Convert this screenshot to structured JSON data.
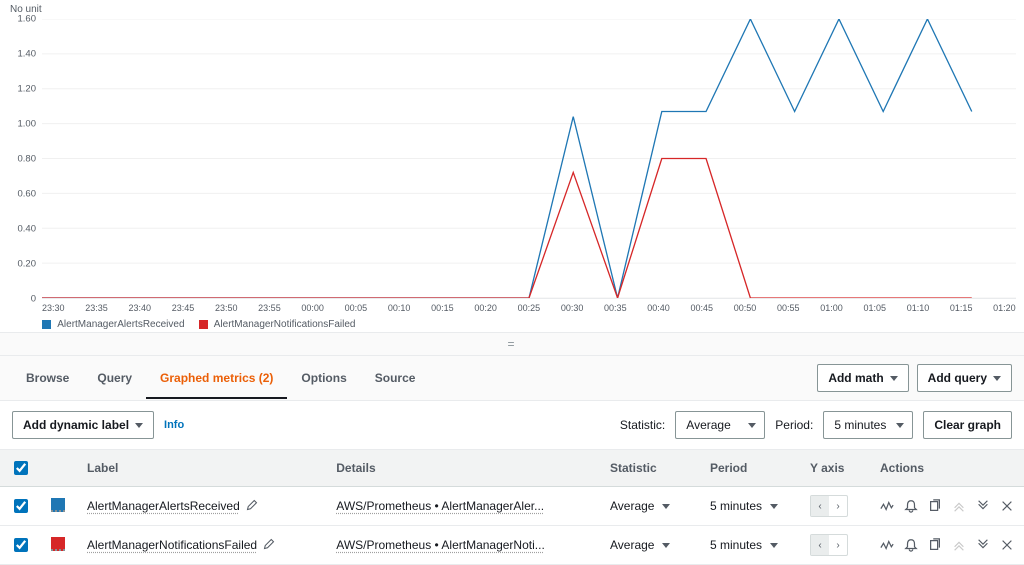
{
  "chart": {
    "nounit_label": "No unit"
  },
  "legend": {
    "series1": "AlertManagerAlertsReceived",
    "series2": "AlertManagerNotificationsFailed"
  },
  "tabs": {
    "browse": "Browse",
    "query": "Query",
    "graphed": "Graphed metrics (2)",
    "options": "Options",
    "source": "Source"
  },
  "toolbar": {
    "add_math": "Add math",
    "add_query": "Add query"
  },
  "controls": {
    "add_dynamic_label": "Add dynamic label",
    "info": "Info",
    "statistic_label": "Statistic:",
    "statistic_value": "Average",
    "period_label": "Period:",
    "period_value": "5 minutes",
    "clear_graph": "Clear graph"
  },
  "table": {
    "headers": {
      "label": "Label",
      "details": "Details",
      "statistic": "Statistic",
      "period": "Period",
      "yaxis": "Y axis",
      "actions": "Actions"
    },
    "rows": [
      {
        "color": "blue",
        "label": "AlertManagerAlertsReceived",
        "details": "AWS/Prometheus • AlertManagerAler...",
        "statistic": "Average",
        "period": "5 minutes"
      },
      {
        "color": "red",
        "label": "AlertManagerNotificationsFailed",
        "details": "AWS/Prometheus • AlertManagerNoti...",
        "statistic": "Average",
        "period": "5 minutes"
      }
    ]
  },
  "chart_data": {
    "type": "line",
    "ylabel": "No unit",
    "ylim": [
      0,
      1.6
    ],
    "yticks": [
      0,
      0.2,
      0.4,
      0.6,
      0.8,
      1.0,
      1.2,
      1.4,
      1.6
    ],
    "xticks": [
      "23:30",
      "23:35",
      "23:40",
      "23:45",
      "23:50",
      "23:55",
      "00:00",
      "00:05",
      "00:10",
      "00:15",
      "00:20",
      "00:25",
      "00:30",
      "00:35",
      "00:40",
      "00:45",
      "00:50",
      "00:55",
      "01:00",
      "01:05",
      "01:10",
      "01:15",
      "01:20"
    ],
    "series": [
      {
        "name": "AlertManagerAlertsReceived",
        "color": "#1f77b4",
        "x": [
          "23:30",
          "23:35",
          "23:40",
          "23:45",
          "23:50",
          "23:55",
          "00:00",
          "00:05",
          "00:10",
          "00:15",
          "00:20",
          "00:25",
          "00:30",
          "00:35",
          "00:40",
          "00:45",
          "00:50",
          "00:55",
          "01:00",
          "01:05",
          "01:10",
          "01:15"
        ],
        "values": [
          0,
          0,
          0,
          0,
          0,
          0,
          0,
          0,
          0,
          0,
          0,
          0,
          1.04,
          0,
          1.07,
          1.07,
          1.6,
          1.07,
          1.6,
          1.07,
          1.6,
          1.07
        ]
      },
      {
        "name": "AlertManagerNotificationsFailed",
        "color": "#d62728",
        "x": [
          "23:30",
          "23:35",
          "23:40",
          "23:45",
          "23:50",
          "23:55",
          "00:00",
          "00:05",
          "00:10",
          "00:15",
          "00:20",
          "00:25",
          "00:30",
          "00:35",
          "00:40",
          "00:45",
          "00:50",
          "00:55",
          "01:00",
          "01:05",
          "01:10",
          "01:15"
        ],
        "values": [
          0,
          0,
          0,
          0,
          0,
          0,
          0,
          0,
          0,
          0,
          0,
          0,
          0.72,
          0,
          0.8,
          0.8,
          0,
          0,
          0,
          0,
          0,
          0
        ]
      }
    ]
  }
}
